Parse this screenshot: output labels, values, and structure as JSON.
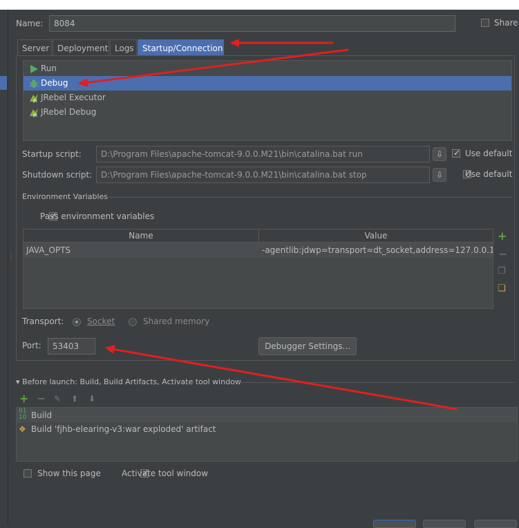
{
  "header": {
    "name_label": "Name:",
    "name_value": "8084",
    "share_label": "Share"
  },
  "tabs": [
    {
      "label": "Server"
    },
    {
      "label": "Deployment"
    },
    {
      "label": "Logs"
    },
    {
      "label": "Startup/Connection"
    }
  ],
  "modes": [
    {
      "label": "Run",
      "icon": "run-icon"
    },
    {
      "label": "Debug",
      "icon": "debug-icon"
    },
    {
      "label": "JRebel Executor",
      "icon": "jrebel-icon"
    },
    {
      "label": "JRebel Debug",
      "icon": "jrebel-debug-icon"
    }
  ],
  "scripts": {
    "startup_label": "Startup script:",
    "startup_value": "D:\\Program Files\\apache-tomcat-9.0.0.M21\\bin\\catalina.bat run",
    "shutdown_label": "Shutdown script:",
    "shutdown_value": "D:\\Program Files\\apache-tomcat-9.0.0.M21\\bin\\catalina.bat stop",
    "use_default": "Use default"
  },
  "env": {
    "section_title": "Environment Variables",
    "pass_label": "Pass environment variables",
    "col_name": "Name",
    "col_value": "Value",
    "rows": [
      {
        "name": "JAVA_OPTS",
        "value": "-agentlib:jdwp=transport=dt_socket,address=127.0.0.1:..."
      }
    ]
  },
  "transport": {
    "label": "Transport:",
    "socket": "Socket",
    "shared_memory": "Shared memory"
  },
  "port": {
    "label": "Port:",
    "value": "53403",
    "debugger_settings": "Debugger Settings..."
  },
  "before_launch": {
    "title": "Before launch: Build, Build Artifacts, Activate tool window",
    "items": [
      {
        "label": "Build"
      },
      {
        "label": "Build 'fjhb-elearing-v3:war exploded' artifact"
      }
    ]
  },
  "footer": {
    "show_page": "Show this page",
    "activate_tool": "Activate tool window"
  },
  "colors": {
    "background": "#3c3f41",
    "selection": "#4b6eaf",
    "annotation_arrow": "#e02020"
  }
}
